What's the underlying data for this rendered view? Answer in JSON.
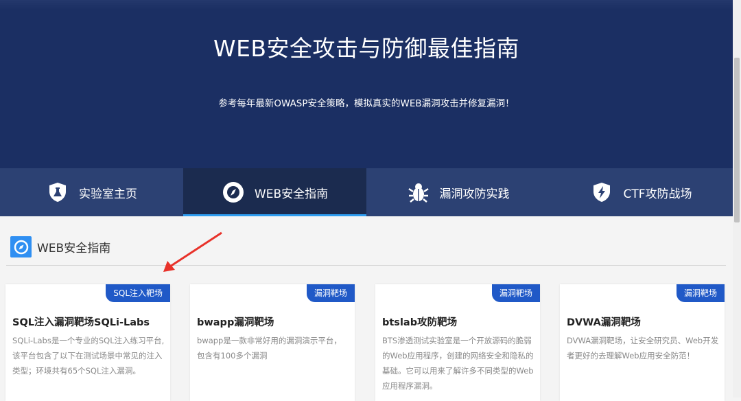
{
  "hero": {
    "title": "WEB安全攻击与防御最佳指南",
    "subtitle": "参考每年最新OWASP安全策略，模拟真实的WEB漏洞攻击并修复漏洞！"
  },
  "nav": {
    "items": [
      {
        "label": "实验室主页",
        "icon": "flask-shield-icon"
      },
      {
        "label": "WEB安全指南",
        "icon": "compass-icon"
      },
      {
        "label": "漏洞攻防实践",
        "icon": "bug-icon"
      },
      {
        "label": "CTF攻防战场",
        "icon": "lightning-shield-icon"
      }
    ],
    "active_index": 1
  },
  "section": {
    "title": "WEB安全指南",
    "icon": "compass-icon"
  },
  "cards": [
    {
      "tag": "SQL注入靶场",
      "title": "SQL注入漏洞靶场SQLi-Labs",
      "desc": "SQLi-Labs是一个专业的SQL注入练习平台,该平台包含了以下在测试场景中常见的注入类型；环境共有65个SQL注入漏洞。"
    },
    {
      "tag": "漏洞靶场",
      "title": "bwapp漏洞靶场",
      "desc": "bwapp是一款非常好用的漏洞演示平台，包含有100多个漏洞"
    },
    {
      "tag": "漏洞靶场",
      "title": "btslab攻防靶场",
      "desc": "BTS渗透测试实验室是一个开放源码的脆弱的Web应用程序，创建的网络安全和隐私的基础。它可以用来了解许多不同类型的Web应用程序漏洞。"
    },
    {
      "tag": "漏洞靶场",
      "title": "DVWA漏洞靶场",
      "desc": "DVWA漏洞靶场，让安全研究员、Web开发者更好的去理解Web应用安全防范！"
    }
  ],
  "colors": {
    "hero_bg": "#1b2f63",
    "nav_bg": "#2c4173",
    "nav_active_bg": "#1b2b4f",
    "accent": "#2e9df0",
    "tag_bg": "#2059c7",
    "annotation_arrow": "#e8322a"
  }
}
